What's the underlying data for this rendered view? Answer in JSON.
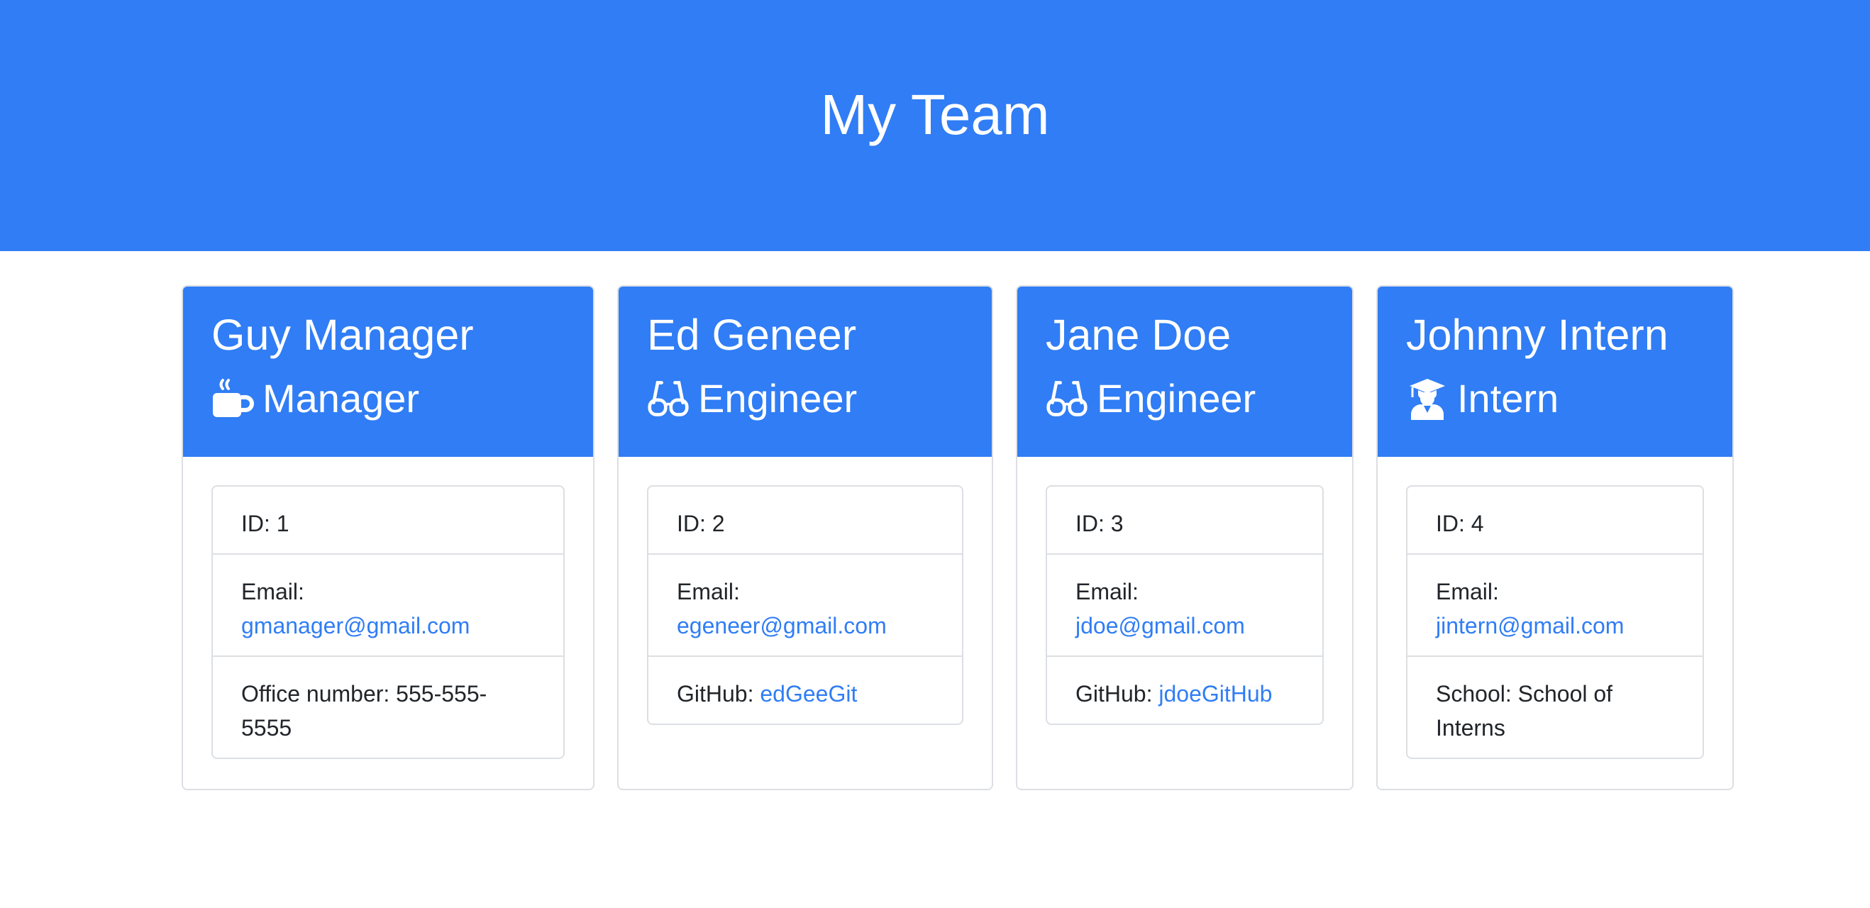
{
  "page": {
    "title": "My Team"
  },
  "colors": {
    "header_bg": "#307df5",
    "link": "#307df5",
    "border": "#dcdfe3"
  },
  "cards": [
    {
      "name": "Guy Manager",
      "role": "Manager",
      "icon": "mug-hot-icon",
      "id_label": "ID: 1",
      "email_label": "Email:",
      "email": "gmanager@gmail.com",
      "extra_label": "Office number: 555-555-",
      "extra_value": "5555"
    },
    {
      "name": "Ed Geneer",
      "role": "Engineer",
      "icon": "glasses-icon",
      "id_label": "ID: 2",
      "email_label": "Email:",
      "email": "egeneer@gmail.com",
      "extra_label": "GitHub:",
      "extra_value": "edGeeGit"
    },
    {
      "name": "Jane Doe",
      "role": "Engineer",
      "icon": "glasses-icon",
      "id_label": "ID: 3",
      "email_label": "Email:",
      "email": "jdoe@gmail.com",
      "extra_label": "GitHub:",
      "extra_value": "jdoeGitHub"
    },
    {
      "name": "Johnny Intern",
      "role": "Intern",
      "icon": "graduate-icon",
      "id_label": "ID: 4",
      "email_label": "Email:",
      "email": "jintern@gmail.com",
      "extra_label": "School: School of",
      "extra_value": "Interns"
    }
  ]
}
